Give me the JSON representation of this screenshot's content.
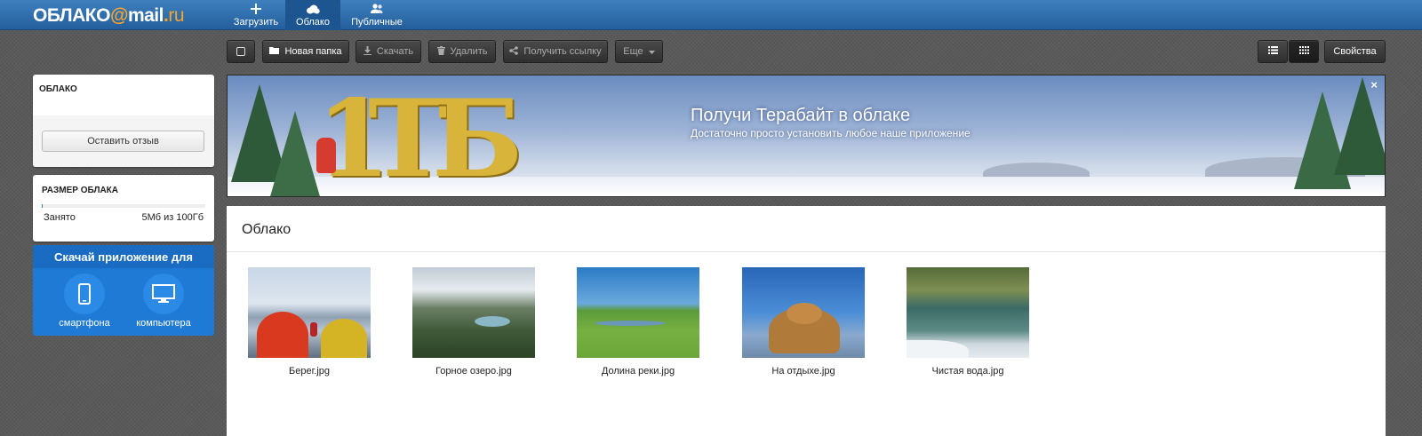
{
  "topbar": {
    "logo": {
      "part1": "ОБЛАКО",
      "at": "@",
      "part2": "mail",
      "dot": ".",
      "part3": "ru"
    },
    "nav": [
      {
        "label": "Загрузить",
        "icon": "plus-icon"
      },
      {
        "label": "Облако",
        "icon": "cloud-icon",
        "active": true
      },
      {
        "label": "Публичные",
        "icon": "users-icon"
      }
    ]
  },
  "toolbar": {
    "new_folder": "Новая папка",
    "download": "Скачать",
    "delete": "Удалить",
    "get_link": "Получить ссылку",
    "more": "Еще",
    "properties": "Свойства"
  },
  "sidebar": {
    "cloud_title": "ОБЛАКО",
    "feedback_button": "Оставить отзыв",
    "size_title": "РАЗМЕР ОБЛАКА",
    "used_label": "Занято",
    "used_value": "5Мб из 100Гб",
    "used_fraction": 5e-05,
    "app_title": "Скачай приложение для",
    "app_smartphone": "смартфона",
    "app_computer": "компьютера"
  },
  "banner": {
    "title": "Получи Терабайт в облаке",
    "subtitle": "Достаточно просто установить любое наше приложение",
    "promo_text": [
      "1",
      "Т",
      "Б"
    ],
    "close": "×"
  },
  "content": {
    "heading": "Облако",
    "files": [
      {
        "name": "Берег.jpg"
      },
      {
        "name": "Горное озеро.jpg"
      },
      {
        "name": "Долина реки.jpg"
      },
      {
        "name": "На отдыхе.jpg"
      },
      {
        "name": "Чистая вода.jpg"
      }
    ]
  },
  "colors": {
    "topbar": "#2f6fb0",
    "accent_orange": "#f6a42a",
    "app_panel": "#1f7ad6"
  }
}
